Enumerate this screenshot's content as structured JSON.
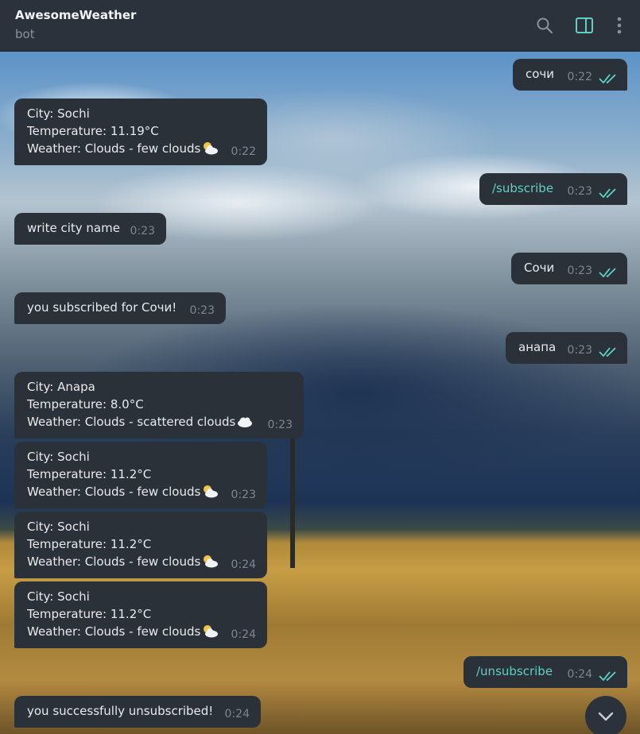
{
  "header": {
    "title": "AwesomeWeather",
    "subtitle": "bot"
  },
  "messages": [
    {
      "dir": "out",
      "text": "сочи",
      "time": "0:22"
    },
    {
      "dir": "in",
      "lines": [
        "City: Sochi",
        "Temperature: 11.19°C",
        "Weather: Clouds - few clouds"
      ],
      "icon": "sun-behind-cloud-icon",
      "time": "0:22"
    },
    {
      "dir": "out",
      "text": "/subscribe",
      "command": true,
      "time": "0:23"
    },
    {
      "dir": "in",
      "text": "write city name",
      "time": "0:23"
    },
    {
      "dir": "out",
      "text": "Сочи",
      "time": "0:23"
    },
    {
      "dir": "in",
      "text": "you subscribed for Сочи!",
      "time": "0:23"
    },
    {
      "dir": "out",
      "text": "анапа",
      "time": "0:23"
    },
    {
      "dir": "in",
      "lines": [
        "City: Anapa",
        "Temperature: 8.0°C",
        "Weather: Clouds - scattered clouds"
      ],
      "icon": "cloud-icon",
      "time": "0:23"
    },
    {
      "dir": "in",
      "lines": [
        "City: Sochi",
        "Temperature: 11.2°C",
        "Weather: Clouds - few clouds"
      ],
      "icon": "sun-behind-cloud-icon",
      "time": "0:23"
    },
    {
      "dir": "in",
      "lines": [
        "City: Sochi",
        "Temperature: 11.2°C",
        "Weather: Clouds - few clouds"
      ],
      "icon": "sun-behind-cloud-icon",
      "time": "0:24"
    },
    {
      "dir": "in",
      "lines": [
        "City: Sochi",
        "Temperature: 11.2°C",
        "Weather: Clouds - few clouds"
      ],
      "icon": "sun-behind-cloud-icon",
      "time": "0:24"
    },
    {
      "dir": "out",
      "text": "/unsubscribe",
      "command": true,
      "time": "0:24"
    },
    {
      "dir": "in",
      "text": "you successfully unsubscribed!",
      "time": "0:24"
    }
  ],
  "colors": {
    "accent": "#5fd0c4",
    "bubble": "#2b3139",
    "header": "#2b323b"
  }
}
